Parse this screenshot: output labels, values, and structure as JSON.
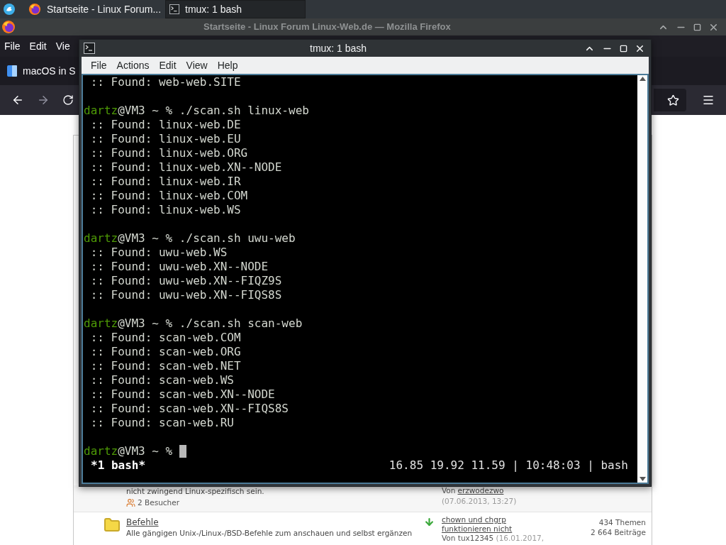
{
  "taskbar": {
    "tasks": [
      {
        "kind": "browser",
        "label": "Startseite - Linux Forum...",
        "selected": false
      },
      {
        "kind": "terminal",
        "label": "tmux: 1 bash",
        "selected": true
      }
    ]
  },
  "browser": {
    "title": "Startseite - Linux Forum Linux-Web.de — Mozilla Firefox",
    "menu": [
      "File",
      "Edit",
      "Vie"
    ],
    "tab": {
      "label": "macOS in S"
    },
    "forum_rows": [
      {
        "description": "nicht zwingend Linux-spezifisch sein.",
        "visitors": "2 Besucher",
        "last_post": {
          "prefix": "Von",
          "author": "erzwodezwo",
          "date": "(07.06.2013, 13:27)"
        }
      },
      {
        "title": "Befehle",
        "description": "Alle gängigen Unix-/Linux-/BSD-Befehle zum anschauen und selbst ergänzen",
        "last_post": {
          "title": "chown und chgrp funktionieren nicht",
          "prefix": "Von",
          "author": "tux12345",
          "date": "(16.01.2017,"
        },
        "stats": [
          "434 Themen",
          "2 664 Beiträge"
        ]
      }
    ]
  },
  "terminal": {
    "title": "tmux: 1 bash",
    "menu": [
      "File",
      "Actions",
      "Edit",
      "View",
      "Help"
    ],
    "lines": [
      {
        "kind": "output",
        "text": " :: Found: web-web.SITE"
      },
      {
        "kind": "blank"
      },
      {
        "kind": "prompt",
        "user": "dartz",
        "host": "@VM3 ~ %",
        "command": "./scan.sh linux-web"
      },
      {
        "kind": "output",
        "text": " :: Found: linux-web.DE"
      },
      {
        "kind": "output",
        "text": " :: Found: linux-web.EU"
      },
      {
        "kind": "output",
        "text": " :: Found: linux-web.ORG"
      },
      {
        "kind": "output",
        "text": " :: Found: linux-web.XN--NODE"
      },
      {
        "kind": "output",
        "text": " :: Found: linux-web.IR"
      },
      {
        "kind": "output",
        "text": " :: Found: linux-web.COM"
      },
      {
        "kind": "output",
        "text": " :: Found: linux-web.WS"
      },
      {
        "kind": "blank"
      },
      {
        "kind": "prompt",
        "user": "dartz",
        "host": "@VM3 ~ %",
        "command": "./scan.sh uwu-web"
      },
      {
        "kind": "output",
        "text": " :: Found: uwu-web.WS"
      },
      {
        "kind": "output",
        "text": " :: Found: uwu-web.XN--NODE"
      },
      {
        "kind": "output",
        "text": " :: Found: uwu-web.XN--FIQZ9S"
      },
      {
        "kind": "output",
        "text": " :: Found: uwu-web.XN--FIQS8S"
      },
      {
        "kind": "blank"
      },
      {
        "kind": "prompt",
        "user": "dartz",
        "host": "@VM3 ~ %",
        "command": "./scan.sh scan-web"
      },
      {
        "kind": "output",
        "text": " :: Found: scan-web.COM"
      },
      {
        "kind": "output",
        "text": " :: Found: scan-web.ORG"
      },
      {
        "kind": "output",
        "text": " :: Found: scan-web.NET"
      },
      {
        "kind": "output",
        "text": " :: Found: scan-web.WS"
      },
      {
        "kind": "output",
        "text": " :: Found: scan-web.XN--NODE"
      },
      {
        "kind": "output",
        "text": " :: Found: scan-web.XN--FIQS8S"
      },
      {
        "kind": "output",
        "text": " :: Found: scan-web.RU"
      },
      {
        "kind": "blank"
      },
      {
        "kind": "prompt",
        "user": "dartz",
        "host": "@VM3 ~ %",
        "cursor": true
      }
    ],
    "status": {
      "left": "*1 bash*",
      "right": "16.85 19.92 11.59 | 10:48:03 | bash"
    }
  }
}
